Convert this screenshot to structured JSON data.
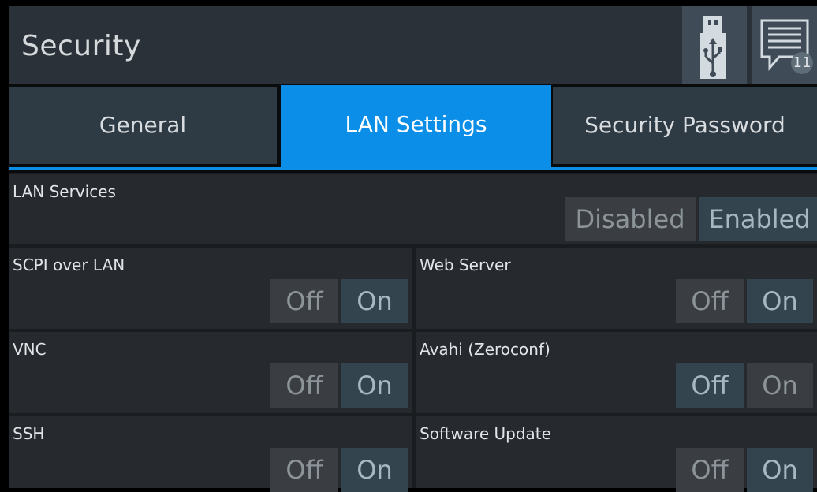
{
  "header": {
    "title": "Security",
    "message_count": "11"
  },
  "tabs": [
    {
      "label": "General",
      "active": false
    },
    {
      "label": "LAN Settings",
      "active": true
    },
    {
      "label": "Security Password",
      "active": false
    }
  ],
  "lan_services": {
    "label": "LAN Services",
    "options": [
      "Disabled",
      "Enabled"
    ],
    "selected": "Enabled"
  },
  "settings": [
    {
      "label": "SCPI over LAN",
      "off": "Off",
      "on": "On",
      "selected": "On"
    },
    {
      "label": "Web Server",
      "off": "Off",
      "on": "On",
      "selected": "On"
    },
    {
      "label": "VNC",
      "off": "Off",
      "on": "On",
      "selected": "On"
    },
    {
      "label": "Avahi (Zeroconf)",
      "off": "Off",
      "on": "On",
      "selected": "Off"
    },
    {
      "label": "SSH",
      "off": "Off",
      "on": "On",
      "selected": "On"
    },
    {
      "label": "Software Update",
      "off": "Off",
      "on": "On",
      "selected": "On"
    }
  ],
  "colors": {
    "accent": "#0a8ee8",
    "header_bg": "#2a3138",
    "panel_bg": "#262a2e"
  }
}
